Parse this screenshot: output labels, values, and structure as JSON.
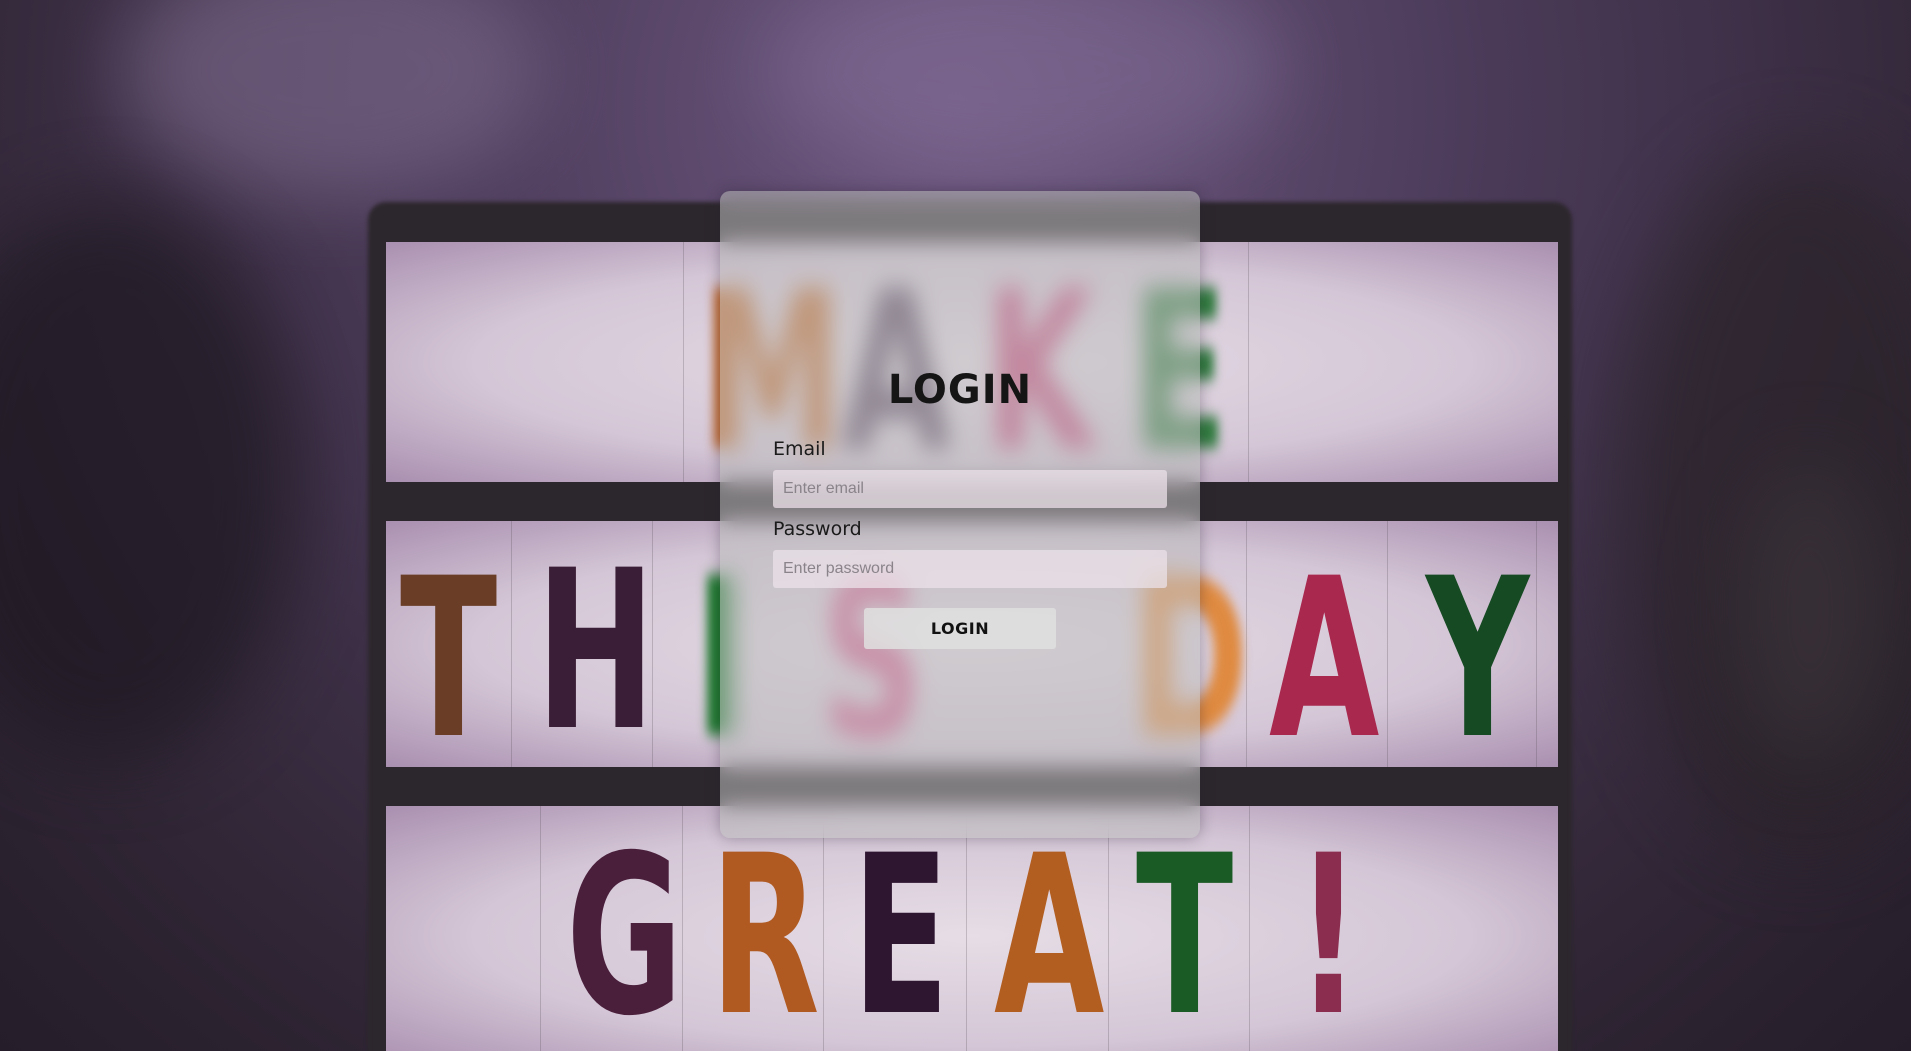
{
  "login_form": {
    "title": "LOGIN",
    "email_label": "Email",
    "email_placeholder": "Enter email",
    "email_value": "",
    "password_label": "Password",
    "password_placeholder": "Enter password",
    "password_value": "",
    "submit_label": "LOGIN"
  },
  "background_sign": {
    "line1": [
      "M",
      "A",
      "K",
      "E"
    ],
    "line2": [
      "T",
      "H",
      "I",
      "S",
      "D",
      "A",
      "Y"
    ],
    "line3": [
      "G",
      "R",
      "E",
      "A",
      "T",
      "!"
    ]
  },
  "colors": {
    "background": "#3a2e42",
    "card": "#bebebe",
    "text": "#151515"
  }
}
